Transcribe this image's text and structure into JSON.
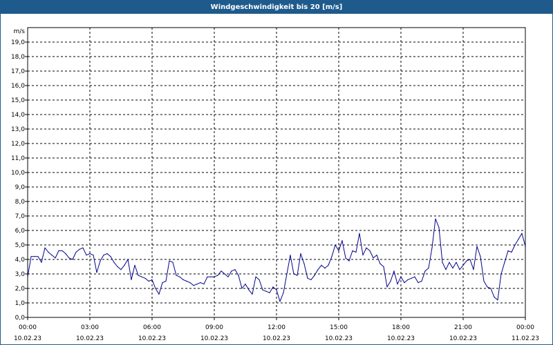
{
  "chart_data": {
    "type": "line",
    "title": "Windgeschwindigkeit bis 20 [m/s]",
    "ylabel": "m/s",
    "ylim": [
      0,
      20
    ],
    "yticks": [
      "0,0",
      "1,0",
      "2,0",
      "3,0",
      "4,0",
      "5,0",
      "6,0",
      "7,0",
      "8,0",
      "9,0",
      "10,0",
      "11,0",
      "12,0",
      "13,0",
      "14,0",
      "15,0",
      "16,0",
      "17,0",
      "18,0",
      "19,0"
    ],
    "xlim": [
      "10.02.23 00:00",
      "11.02.23 00:00"
    ],
    "xticks": [
      {
        "time": "00:00",
        "date": "10.02.23"
      },
      {
        "time": "03:00",
        "date": "10.02.23"
      },
      {
        "time": "06:00",
        "date": "10.02.23"
      },
      {
        "time": "09:00",
        "date": "10.02.23"
      },
      {
        "time": "12:00",
        "date": "10.02.23"
      },
      {
        "time": "15:00",
        "date": "10.02.23"
      },
      {
        "time": "18:00",
        "date": "10.02.23"
      },
      {
        "time": "21:00",
        "date": "10.02.23"
      },
      {
        "time": "00:00",
        "date": "11.02.23"
      }
    ],
    "grid": true,
    "line_color": "#00008b",
    "series": [
      {
        "x": [
          "00:00",
          "00:10",
          "00:20",
          "00:30",
          "00:40",
          "00:50",
          "01:00",
          "01:10",
          "01:20",
          "01:30",
          "01:40",
          "01:50",
          "02:00",
          "02:10",
          "02:20",
          "02:30",
          "02:40",
          "02:50",
          "03:00",
          "03:10",
          "03:20",
          "03:30",
          "03:40",
          "03:50",
          "04:00",
          "04:10",
          "04:20",
          "04:30",
          "04:40",
          "04:50",
          "05:00",
          "05:10",
          "05:20",
          "05:30",
          "05:40",
          "05:50",
          "06:00",
          "06:10",
          "06:20",
          "06:30",
          "06:40",
          "06:50",
          "07:00",
          "07:10",
          "07:20",
          "07:30",
          "07:40",
          "07:50",
          "08:00",
          "08:10",
          "08:20",
          "08:30",
          "08:40",
          "08:50",
          "09:00",
          "09:10",
          "09:20",
          "09:30",
          "09:40",
          "09:50",
          "10:00",
          "10:10",
          "10:20",
          "10:30",
          "10:40",
          "10:50",
          "11:00",
          "11:10",
          "11:20",
          "11:30",
          "11:40",
          "11:50",
          "12:00",
          "12:10",
          "12:20",
          "12:30",
          "12:40",
          "12:50",
          "13:00",
          "13:10",
          "13:20",
          "13:30",
          "13:40",
          "13:50",
          "14:00",
          "14:10",
          "14:20",
          "14:30",
          "14:40",
          "14:50",
          "15:00",
          "15:10",
          "15:20",
          "15:30",
          "15:40",
          "15:50",
          "16:00",
          "16:10",
          "16:20",
          "16:30",
          "16:40",
          "16:50",
          "17:00",
          "17:10",
          "17:20",
          "17:30",
          "17:40",
          "17:50",
          "18:00",
          "18:10",
          "18:20",
          "18:30",
          "18:40",
          "18:50",
          "19:00",
          "19:10",
          "19:20",
          "19:30",
          "19:40",
          "19:50",
          "20:00",
          "20:10",
          "20:20",
          "20:30",
          "20:40",
          "20:50",
          "21:00",
          "21:10",
          "21:20",
          "21:30",
          "21:40",
          "21:50",
          "22:00",
          "22:10",
          "22:20",
          "22:30",
          "22:40",
          "22:50",
          "23:00",
          "23:10",
          "23:20",
          "23:30",
          "23:40",
          "23:50",
          "24:00"
        ],
        "y": [
          2.8,
          4.2,
          4.2,
          4.2,
          3.8,
          4.8,
          4.5,
          4.3,
          4.1,
          4.6,
          4.6,
          4.4,
          4.1,
          4.0,
          4.5,
          4.7,
          4.8,
          4.3,
          4.4,
          4.3,
          3.1,
          3.9,
          4.3,
          4.4,
          4.2,
          3.8,
          3.5,
          3.3,
          3.6,
          4.0,
          2.6,
          3.6,
          2.9,
          2.8,
          2.7,
          2.5,
          2.6,
          2.0,
          1.6,
          2.4,
          2.5,
          3.9,
          3.8,
          2.9,
          2.8,
          2.6,
          2.5,
          2.4,
          2.2,
          2.3,
          2.4,
          2.3,
          2.8,
          2.8,
          2.8,
          2.9,
          3.2,
          3.0,
          2.8,
          3.2,
          3.3,
          2.9,
          2.0,
          2.3,
          1.9,
          1.6,
          2.8,
          2.6,
          1.9,
          1.8,
          1.7,
          2.1,
          1.9,
          1.1,
          1.7,
          3.0,
          4.3,
          3.0,
          2.9,
          4.4,
          3.7,
          2.7,
          2.6,
          2.9,
          3.3,
          3.6,
          3.4,
          3.6,
          4.2,
          5.0,
          4.6,
          5.3,
          4.1,
          3.9,
          4.6,
          4.5,
          5.8,
          4.3,
          4.8,
          4.6,
          4.1,
          4.3,
          3.7,
          3.5,
          2.1,
          2.5,
          3.2,
          2.3,
          2.8,
          2.4,
          2.6,
          2.7,
          2.8,
          2.4,
          2.5,
          3.2,
          3.4,
          4.8,
          6.8,
          6.2,
          3.8,
          3.3,
          3.8,
          3.4,
          3.8,
          3.3,
          3.6,
          3.9,
          4.0,
          3.3,
          4.9,
          4.2,
          2.5,
          2.1,
          2.0,
          1.4,
          1.2,
          3.0,
          3.8,
          4.6,
          4.5,
          5.0,
          5.4,
          5.8,
          4.9
        ]
      }
    ]
  }
}
